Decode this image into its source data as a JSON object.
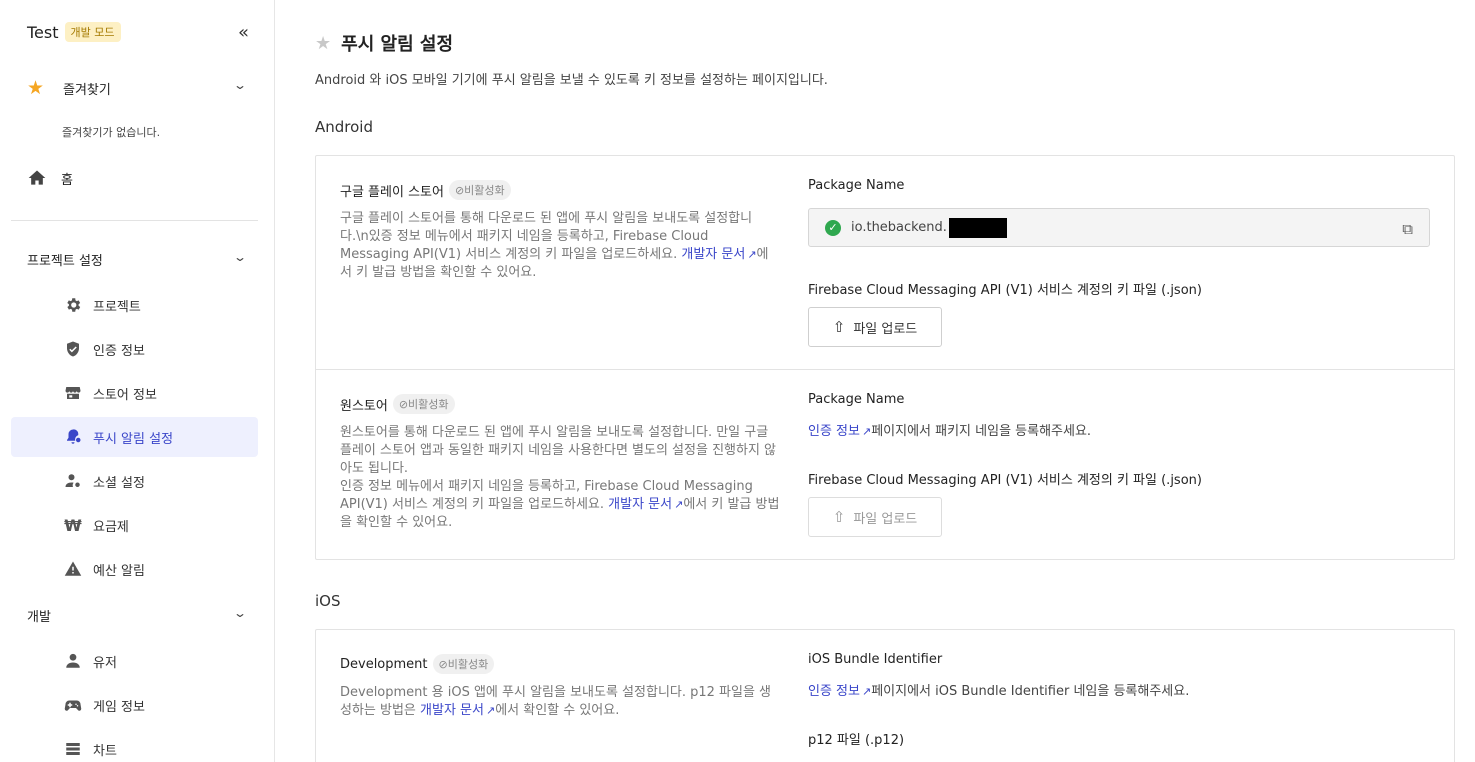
{
  "sidebar": {
    "project": "Test",
    "mode_badge": "개발 모드",
    "collapse_icon": "«",
    "favorites": {
      "label": "즐겨찾기",
      "empty": "즐겨찾기가 없습니다."
    },
    "home": {
      "label": "홈"
    },
    "project_section": "프로젝트 설정",
    "items": [
      {
        "label": "프로젝트"
      },
      {
        "label": "인증 정보"
      },
      {
        "label": "스토어 정보"
      },
      {
        "label": "푸시 알림 설정"
      },
      {
        "label": "소셜 설정"
      },
      {
        "label": "요금제"
      },
      {
        "label": "예산 알림"
      }
    ],
    "dev_section": "개발",
    "dev_items": [
      {
        "label": "유저"
      },
      {
        "label": "게임 정보"
      },
      {
        "label": "차트"
      }
    ]
  },
  "main": {
    "title": "푸시 알림 설정",
    "description": "Android 와 iOS 모바일 기기에 푸시 알림을 보낼 수 있도록 키 정보를 설정하는 페이지입니다.",
    "android": {
      "title": "Android",
      "google": {
        "title": "구글 플레이 스토어",
        "status": "⊘비활성화",
        "desc": "구글 플레이 스토어를 통해 다운로드 된 앱에 푸시 알림을 보내도록 설정합니다.\\n있증 정보 메뉴에서 패키지 네임을 등록하고, Firebase Cloud Messaging API(V1) 서비스 계정의 키 파일을 업로드하세요. ",
        "doc_link": "개발자 문서",
        "desc_tail": "에서 키 발급 방법을 확인할 수 있어요.",
        "pkg_label": "Package Name",
        "pkg_value": "io.thebackend.",
        "key_label": "Firebase Cloud Messaging API (V1) 서비스 계정의 키 파일 (.json)",
        "upload": "파일 업로드"
      },
      "one": {
        "title": "원스토어",
        "status": "⊘비활성화",
        "desc": "원스토어를 통해 다운로드 된 앱에 푸시 알림을 보내도록 설정합니다. 만일 구글 플레이 스토어 앱과 동일한 패키지 네임을 사용한다면 별도의 설정을 진행하지 않아도 됩니다.",
        "desc2": "인증 정보 메뉴에서 패키지 네임을 등록하고, Firebase Cloud Messaging API(V1) 서비스 계정의 키 파일을 업로드하세요. ",
        "doc_link": "개발자 문서",
        "desc_tail": "에서 키 발급 방법을 확인할 수 있어요.",
        "pkg_label": "Package Name",
        "auth_link": "인증 정보",
        "pkg_hint": "페이지에서 패키지 네임을 등록해주세요.",
        "key_label": "Firebase Cloud Messaging API (V1) 서비스 계정의 키 파일 (.json)",
        "upload": "파일 업로드"
      }
    },
    "ios": {
      "title": "iOS",
      "dev": {
        "title": "Development",
        "status": "⊘비활성화",
        "desc": "Development 용 iOS 앱에 푸시 알림을 보내도록 설정합니다. p12 파일을 생성하는 방법은 ",
        "doc_link": "개발자 문서",
        "desc_tail": "에서 확인할 수 있어요.",
        "bundle_label": "iOS Bundle Identifier",
        "auth_link": "인증 정보",
        "bundle_hint": "페이지에서 iOS Bundle Identifier 네임을 등록해주세요.",
        "p12_label": "p12 파일 (.p12)"
      }
    }
  }
}
